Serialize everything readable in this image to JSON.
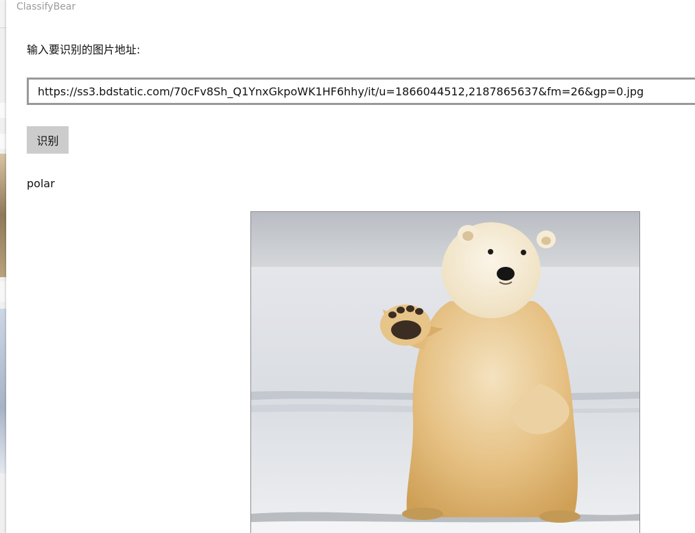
{
  "window": {
    "title": "ClassifyBear"
  },
  "form": {
    "prompt_label": "输入要识别的图片地址:",
    "url_value": "https://ss3.bdstatic.com/70cFv8Sh_Q1YnxGkpoWK1HF6hhy/it/u=1866044512,2187865637&fm=26&gp=0.jpg",
    "recognize_label": "识别"
  },
  "result": {
    "label": "polar"
  },
  "photo": {
    "subject": "polar bear standing on snow, waving one paw"
  },
  "colors": {
    "button_bg": "#cccccc",
    "input_border": "#999999",
    "title_text": "#9a9a9a"
  }
}
